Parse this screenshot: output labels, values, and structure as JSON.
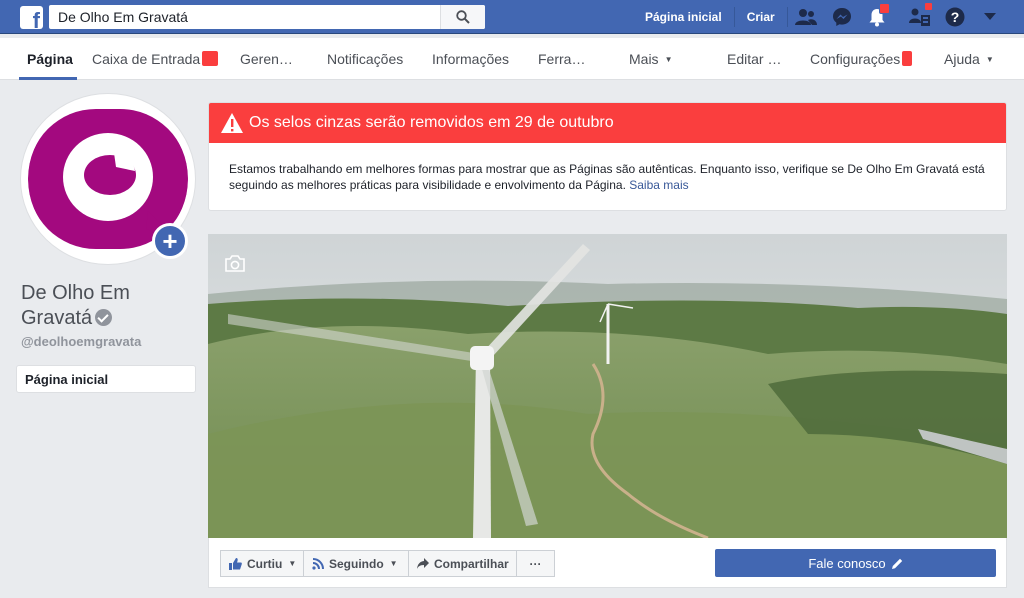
{
  "topbar": {
    "search_value": "De Olho Em Gravatá",
    "home_link": "Página inicial",
    "create_link": "Criar"
  },
  "pagenav": {
    "items": [
      {
        "label": "Página"
      },
      {
        "label": "Caixa de Entrada"
      },
      {
        "label": "Geren…"
      },
      {
        "label": "Notificações"
      },
      {
        "label": "Informações"
      },
      {
        "label": "Ferra…"
      },
      {
        "label": "Mais"
      },
      {
        "label": "Editar …"
      },
      {
        "label": "Configurações"
      },
      {
        "label": "Ajuda"
      }
    ]
  },
  "sidebar": {
    "page_name": "De Olho Em Gravatá",
    "handle": "@deolhoemgravata",
    "home_item": "Página inicial"
  },
  "alert": {
    "title": "Os selos cinzas serão removidos em 29 de outubro",
    "body": "Estamos trabalhando em melhores formas para mostrar que as Páginas são autênticas. Enquanto isso, verifique se De Olho Em Gravatá está seguindo as melhores práticas para visibilidade e envolvimento da Página.",
    "link": "Saiba mais"
  },
  "actions": {
    "like": "Curtiu",
    "follow": "Seguindo",
    "share": "Compartilhar",
    "more": "···",
    "contact": "Fale conosco"
  },
  "colors": {
    "brand": "#4267b2",
    "alert": "#fa3e3e",
    "avatar": "#a3097f"
  },
  "icons": [
    "facebook-logo",
    "search-icon",
    "friends-icon",
    "messenger-icon",
    "bell-icon",
    "pages-icon",
    "help-icon",
    "chevron-down-icon",
    "camera-icon",
    "plus-icon",
    "warning-icon",
    "thumbs-up-icon",
    "rss-icon",
    "share-icon",
    "pencil-icon",
    "verified-icon"
  ]
}
